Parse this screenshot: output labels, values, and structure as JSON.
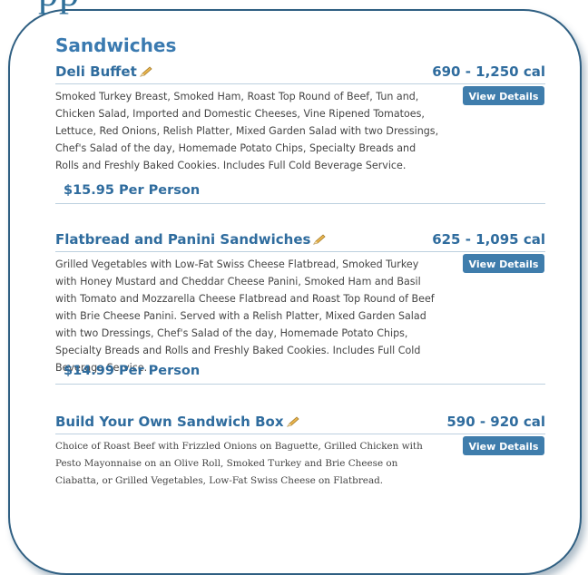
{
  "page": {
    "cut_heading": "pp",
    "title": "Sandwiches"
  },
  "items": [
    {
      "name": "Deli Buffet",
      "calories": "690 - 1,250 cal",
      "description": "Smoked Turkey Breast, Smoked Ham, Roast Top Round of Beef, Tun and, Chicken Salad, Imported and Domestic Cheeses, Vine Ripened Tomatoes, Lettuce, Red Onions, Relish Platter, Mixed Garden Salad with two Dressings, Chef's Salad of the day, Homemade Potato Chips, Specialty Breads and Rolls and Freshly Baked Cookies. Includes Full Cold Beverage Service.",
      "price": "$15.95 Per Person",
      "button_label": "View Details"
    },
    {
      "name": "Flatbread and Panini Sandwiches",
      "calories": "625 - 1,095 cal",
      "description": "Grilled Vegetables with Low-Fat Swiss Cheese Flatbread, Smoked Turkey with Honey Mustard and Cheddar Cheese Panini, Smoked Ham and Basil with Tomato and Mozzarella Cheese Flatbread and Roast Top Round of Beef with Brie Cheese Panini. Served with a Relish Platter, Mixed Garden Salad with two Dressings, Chef's Salad of the day, Homemade Potato Chips, Specialty Breads and Rolls and Freshly Baked Cookies. Includes Full Cold Beverage Service.",
      "price": "$14.99 Per Person",
      "button_label": "View Details"
    },
    {
      "name": "Build Your Own Sandwich Box",
      "calories": "590 - 920 cal",
      "description": "Choice of Roast Beef with Frizzled Onions on Baguette, Grilled Chicken with Pesto Mayonnaise on an Olive Roll, Smoked Turkey and Brie Cheese on Ciabatta, or Grilled Vegetables, Low-Fat Swiss Cheese on Flatbread.",
      "button_label": "View Details"
    }
  ],
  "colors": {
    "accent": "#2f6c9e",
    "button": "#3f7dac",
    "frame_border": "#2f5f82"
  },
  "icons": {
    "edit": "pencil-icon"
  }
}
